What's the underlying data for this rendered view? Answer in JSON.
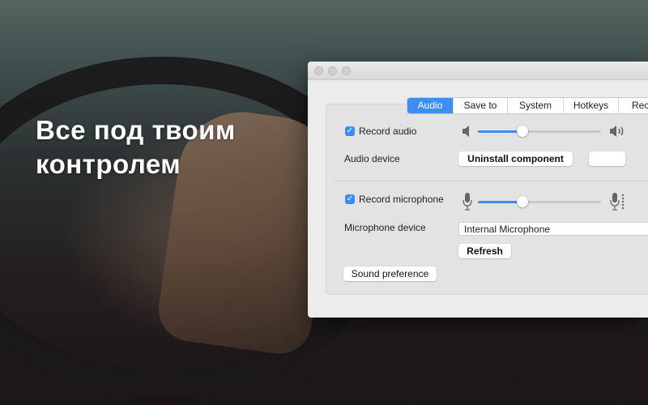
{
  "hero": {
    "headline": "Все под твоим\nконтролем"
  },
  "tabs": [
    {
      "label": "Audio",
      "active": true
    },
    {
      "label": "Save to",
      "active": false
    },
    {
      "label": "System",
      "active": false
    },
    {
      "label": "Hotkeys",
      "active": false
    },
    {
      "label": "Reco",
      "active": false
    }
  ],
  "audio": {
    "record_audio_label": "Record audio",
    "record_audio_checked": true,
    "volume": 0.36,
    "device_label": "Audio device",
    "uninstall_label": "Uninstall component",
    "extra_button_label": ""
  },
  "microphone": {
    "record_microphone_label": "Record microphone",
    "record_microphone_checked": true,
    "volume": 0.36,
    "device_label": "Microphone device",
    "device_value": "Internal Microphone",
    "refresh_label": "Refresh"
  },
  "sound_preference_label": "Sound preference",
  "icons": {
    "volume_low": "speaker-low-icon",
    "volume_high": "speaker-high-icon",
    "mic_low": "microphone-icon",
    "mic_high": "microphone-level-icon"
  },
  "colors": {
    "accent": "#3b8ef3",
    "window_bg": "#ececec"
  }
}
